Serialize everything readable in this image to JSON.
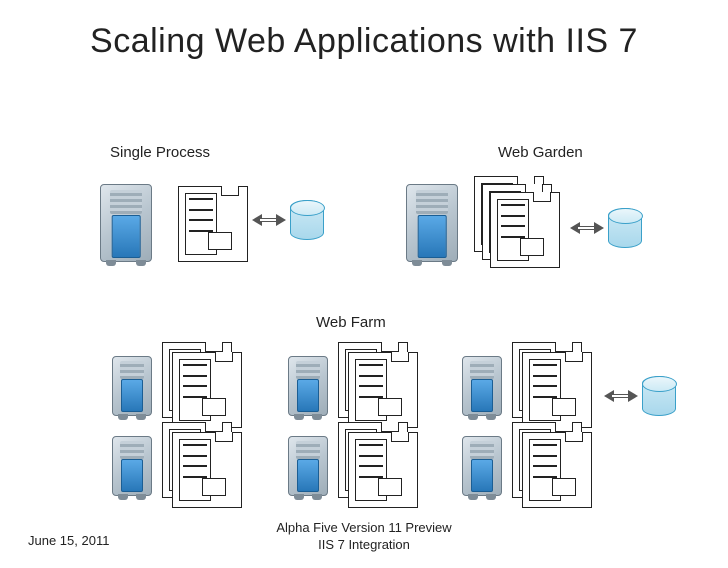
{
  "title": "Scaling Web Applications with IIS 7",
  "labels": {
    "single_process": "Single Process",
    "web_garden": "Web Garden",
    "web_farm": "Web Farm"
  },
  "footer": {
    "date": "June 15, 2011",
    "center": "Alpha Five Version 11 Preview\nIIS 7 Integration"
  },
  "icons": {
    "server": "server-tower",
    "process_box": "worker-process",
    "database": "cylinder-db",
    "arrow": "bidirectional-arrow"
  }
}
